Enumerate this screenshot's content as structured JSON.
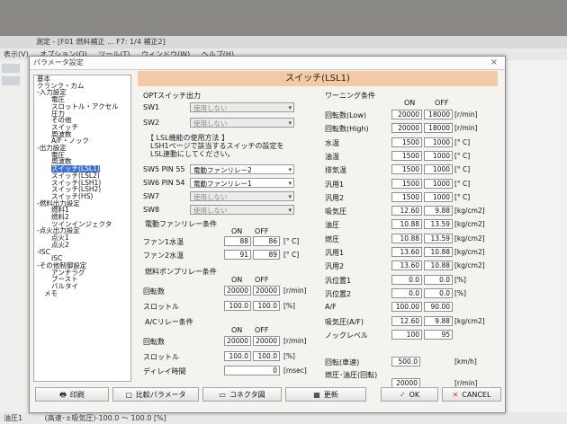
{
  "bg": {
    "title": "測定 - [F01 燃料補正 ... F7: 1/4 補正2]",
    "menu": [
      "表示(V)",
      "オプション(O)",
      "ツール(T)",
      "ウィンドウ(W)",
      "ヘルプ(H)"
    ],
    "status": [
      "油圧1",
      "(高速･±吸気圧)-100.0 ～ 100.0 [%]"
    ]
  },
  "dialog": {
    "title": "パラメータ設定",
    "close": "×",
    "heading": "スイッチ(LSL1)"
  },
  "tree": [
    {
      "label": "基本",
      "indent": 0
    },
    {
      "label": "クランク・カム",
      "indent": 0
    },
    {
      "label": "入力設定",
      "indent": 0,
      "toggle": "-"
    },
    {
      "label": "電圧",
      "indent": 2
    },
    {
      "label": "スロットル・アクセル",
      "indent": 2
    },
    {
      "label": "圧力",
      "indent": 2
    },
    {
      "label": "その他",
      "indent": 2
    },
    {
      "label": "スイッチ",
      "indent": 2
    },
    {
      "label": "周波数",
      "indent": 2
    },
    {
      "label": "A/F・ノック",
      "indent": 2
    },
    {
      "label": "出力設定",
      "indent": 0,
      "toggle": "-"
    },
    {
      "label": "電圧",
      "indent": 2
    },
    {
      "label": "周波数",
      "indent": 2
    },
    {
      "label": "スイッチ(LSL1)",
      "indent": 2,
      "selected": true
    },
    {
      "label": "スイッチ(LSL2)",
      "indent": 2
    },
    {
      "label": "スイッチ(LSH1)",
      "indent": 2
    },
    {
      "label": "スイッチ(LSH2)",
      "indent": 2
    },
    {
      "label": "スイッチ(HS)",
      "indent": 2
    },
    {
      "label": "燃料出力設定",
      "indent": 0,
      "toggle": "-"
    },
    {
      "label": "燃料1",
      "indent": 2
    },
    {
      "label": "燃料2",
      "indent": 2
    },
    {
      "label": "ツインインジェクタ",
      "indent": 2
    },
    {
      "label": "点火出力設定",
      "indent": 0,
      "toggle": "-"
    },
    {
      "label": "点火1",
      "indent": 2
    },
    {
      "label": "点火2",
      "indent": 2
    },
    {
      "label": "ISC",
      "indent": 0,
      "toggle": "-"
    },
    {
      "label": "ISC",
      "indent": 2
    },
    {
      "label": "その他制御設定",
      "indent": 0,
      "toggle": "-"
    },
    {
      "label": "アンチラグ",
      "indent": 2
    },
    {
      "label": "ブースト",
      "indent": 2
    },
    {
      "label": "バルタイ",
      "indent": 2
    },
    {
      "label": "メモ",
      "indent": 1
    }
  ],
  "opt": {
    "title": "OPTスイッチ出力",
    "sw1": {
      "label": "SW1",
      "value": "使用しない"
    },
    "sw2": {
      "label": "SW2",
      "value": "使用しない"
    },
    "info": [
      "【 LSL機能の使用方法 】",
      "LSH1ページで該当するスイッチの設定を",
      "LSL連動にしてください。"
    ],
    "sw5": {
      "label": "SW5 PIN 55",
      "value": "電動ファンリレー2"
    },
    "sw6": {
      "label": "SW6 PIN 54",
      "value": "電動ファンリレー1"
    },
    "sw7": {
      "label": "SW7",
      "value": "使用しない"
    },
    "sw8": {
      "label": "SW8",
      "value": "使用しない"
    }
  },
  "fan": {
    "title": "電動ファンリレー条件",
    "on": "ON",
    "off": "OFF",
    "rows": [
      {
        "label": "ファン1水温",
        "on": "88",
        "off": "86",
        "unit": "[° C]"
      },
      {
        "label": "ファン2水温",
        "on": "91",
        "off": "89",
        "unit": "[° C]"
      }
    ]
  },
  "pump": {
    "title": "燃料ポンプリレー条件",
    "on": "ON",
    "off": "OFF",
    "rows": [
      {
        "label": "回転数",
        "on": "20000",
        "off": "20000",
        "unit": "[r/min]"
      },
      {
        "label": "スロットル",
        "on": "100.0",
        "off": "100.0",
        "unit": "[%]"
      }
    ]
  },
  "ac": {
    "title": "A/Cリレー条件",
    "on": "ON",
    "off": "OFF",
    "rows": [
      {
        "label": "回転数",
        "on": "20000",
        "off": "20000",
        "unit": "[r/min]"
      },
      {
        "label": "スロットル",
        "on": "100.0",
        "off": "100.0",
        "unit": "[%]"
      }
    ],
    "delay": {
      "label": "ディレイ時間",
      "value": "0",
      "unit": "[msec]"
    }
  },
  "warning": {
    "title": "ワーニング条件",
    "on": "ON",
    "off": "OFF",
    "rows": [
      {
        "label": "回転数(Low)",
        "on": "20000",
        "off": "18000",
        "unit": "[r/min]"
      },
      {
        "label": "回転数(High)",
        "on": "20000",
        "off": "18000",
        "unit": "[r/min]"
      },
      {
        "label": "水温",
        "on": "1500",
        "off": "1000",
        "unit": "[° C]"
      },
      {
        "label": "油温",
        "on": "1500",
        "off": "1000",
        "unit": "[° C]"
      },
      {
        "label": "排気温",
        "on": "1500",
        "off": "1000",
        "unit": "[° C]"
      },
      {
        "label": "汎用1",
        "on": "1500",
        "off": "1000",
        "unit": "[° C]"
      },
      {
        "label": "汎用2",
        "on": "1500",
        "off": "1000",
        "unit": "[° C]"
      },
      {
        "label": "吸気圧",
        "on": "12.60",
        "off": "9.88",
        "unit": "[kg/cm2]"
      },
      {
        "label": "油圧",
        "on": "10.88",
        "off": "13.59",
        "unit": "[kg/cm2]"
      },
      {
        "label": "燃圧",
        "on": "10.88",
        "off": "13.59",
        "unit": "[kg/cm2]"
      },
      {
        "label": "汎用1",
        "on": "13.60",
        "off": "10.88",
        "unit": "[kg/cm2]"
      },
      {
        "label": "汎用2",
        "on": "13.60",
        "off": "10.88",
        "unit": "[kg/cm2]"
      },
      {
        "label": "汎位置1",
        "on": "0.0",
        "off": "0.0",
        "unit": "[%]"
      },
      {
        "label": "汎位置2",
        "on": "0.0",
        "off": "0.0",
        "unit": "[%]"
      },
      {
        "label": "A/F",
        "on": "100.00",
        "off": "90.00",
        "unit": ""
      },
      {
        "label": "吸気圧(A/F)",
        "on": "12.60",
        "off": "9.88",
        "unit": "[kg/cm2]"
      },
      {
        "label": "ノックレベル",
        "on": "100",
        "off": "95",
        "unit": ""
      }
    ],
    "speed": {
      "label": "回転(車速)",
      "value": "500.0",
      "unit": "[km/h]"
    },
    "fuelcut": {
      "label": "燃圧･油圧(回転)",
      "value": "20000",
      "unit": "[r/min]"
    }
  },
  "buttons": {
    "print": "印刷",
    "compare": "比較パラメータ",
    "connector": "コネクタ図",
    "update": "更新",
    "ok": "OK",
    "cancel": "CANCEL"
  },
  "colors": {
    "header": "#f4c9a6",
    "selection": "#3d6fd1",
    "cancel": "#c0392b",
    "ok": "#2a8a3a"
  }
}
